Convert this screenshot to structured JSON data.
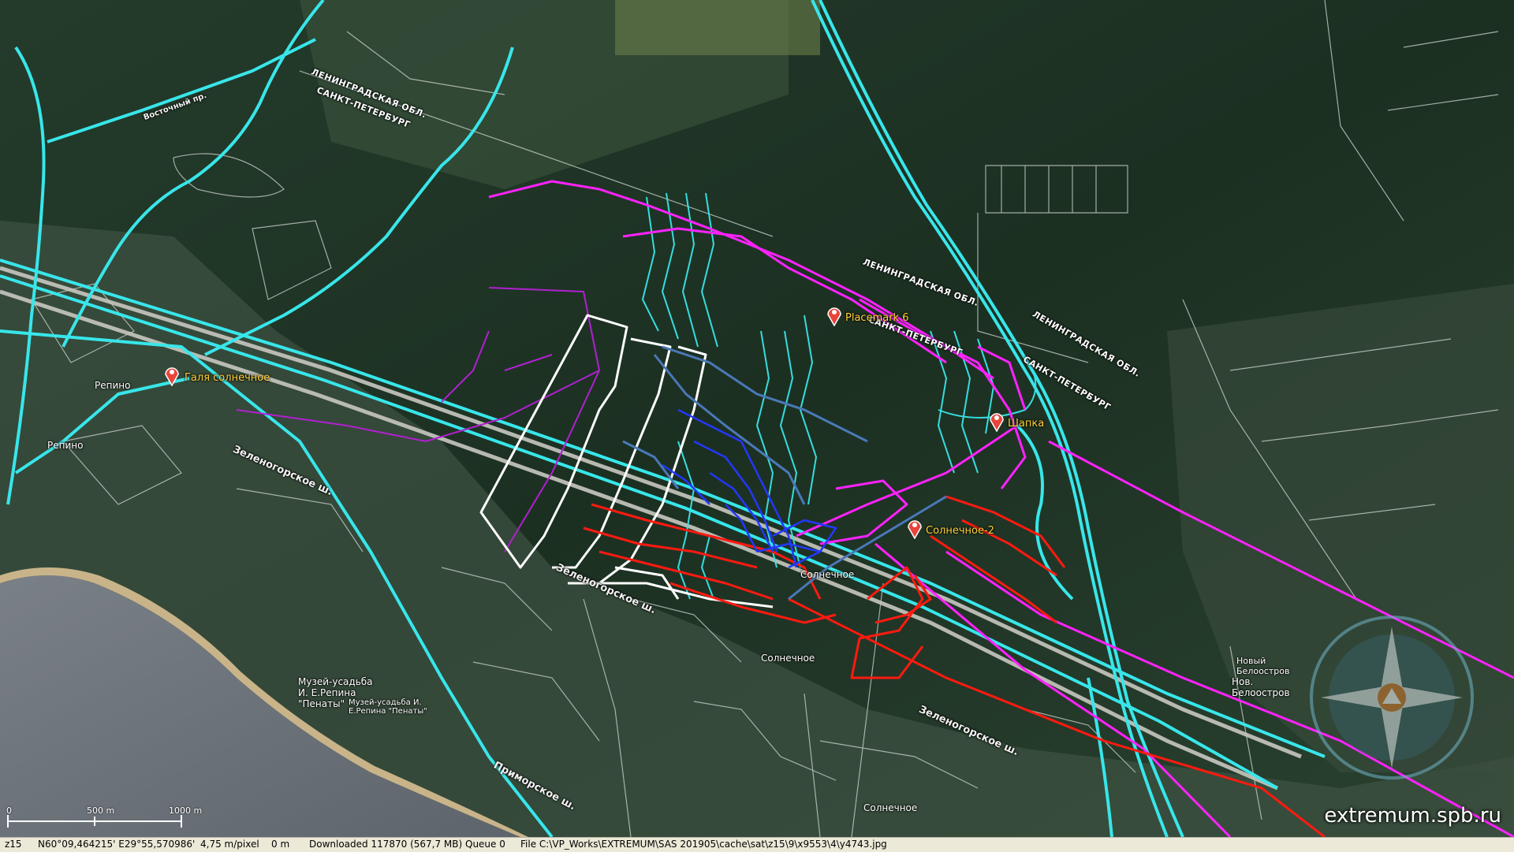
{
  "colors": {
    "cyan_track": "#38e6ea",
    "magenta_track": "#ff22ff",
    "purple_track": "#b020d0",
    "white_track": "#ffffff",
    "red_track": "#ff1a10",
    "blue_track": "#2238ff",
    "steel_track": "#4a78b8",
    "pin": "#e8443a"
  },
  "map": {
    "region_labels": [
      {
        "text": "ЛЕНИНГРАДСКАЯ ОБЛ.",
        "name": "region-label-lo-1"
      },
      {
        "text": "САНКТ-ПЕТЕРБУРГ",
        "name": "region-label-spb-1"
      },
      {
        "text": "ЛЕНИНГРАДСКАЯ ОБЛ.",
        "name": "region-label-lo-2"
      },
      {
        "text": "САНКТ-ПЕТЕРБУРГ",
        "name": "region-label-spb-2"
      },
      {
        "text": "ЛЕНИНГРАДСКАЯ ОБЛ.",
        "name": "region-label-lo-3"
      },
      {
        "text": "САНКТ-ПЕТЕРБУРГ",
        "name": "region-label-spb-3"
      }
    ],
    "road_labels": [
      "Зеленогорское ш.",
      "Зеленогорское ш.",
      "Зеленогорское ш.",
      "Приморское ш.",
      "Восточный пр."
    ],
    "place_labels": [
      "Репино",
      "Репино",
      "Солнечное",
      "Солнечное",
      "Солнечное",
      "Новый Белоостров",
      "Нов. Белоостров",
      "Музей-усадьба И. Е.Репина \"Пенаты\"",
      "Музей-усадьба И. Е.Репина \"Пенаты\""
    ],
    "placemarks": [
      {
        "label": "Placemark 6"
      },
      {
        "label": "Шапка"
      },
      {
        "label": "Солнечное-2"
      },
      {
        "label": "Галя солнечное"
      }
    ],
    "scale": {
      "label_0": "0",
      "label_mid": "500 m",
      "label_end": "1000 m"
    },
    "watermark": "extremum.spb.ru"
  },
  "statusbar": {
    "zoom": "z15",
    "coordinates": "N60°09,464215' E29°55,570986'",
    "resolution": "4,75 m/pixel",
    "distance": "0 m",
    "downloaded": "Downloaded 117870 (567,7 MB)",
    "queue": "Queue 0",
    "file": "File C:\\VP_Works\\EXTREMUM\\SAS 201905\\cache\\sat\\z15\\9\\x9553\\4\\y4743.jpg"
  }
}
